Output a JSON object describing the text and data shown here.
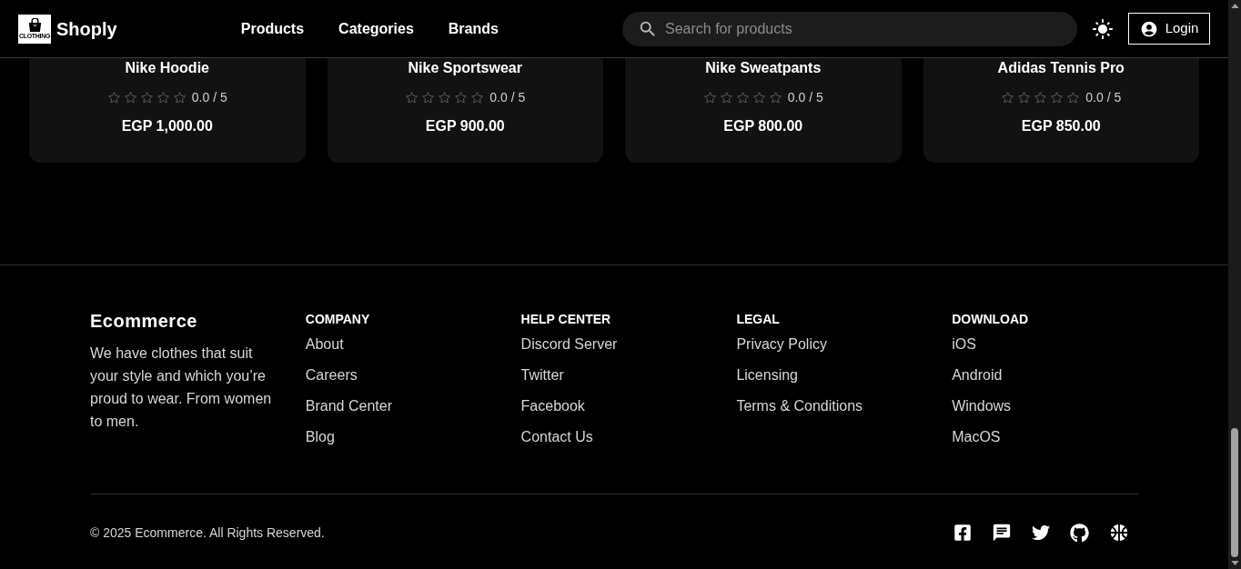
{
  "header": {
    "logo_text": "CLOTHING",
    "brand": "Shoply",
    "nav": [
      "Products",
      "Categories",
      "Brands"
    ],
    "search": {
      "placeholder": "Search for products"
    },
    "login": "Login"
  },
  "products": [
    {
      "name": "Nike Hoodie",
      "stars": 0,
      "rating": "0.0 / 5",
      "price": "EGP 1,000.00"
    },
    {
      "name": "Nike Sportswear",
      "stars": 0,
      "rating": "0.0 / 5",
      "price": "EGP 900.00"
    },
    {
      "name": "Nike Sweatpants",
      "stars": 0,
      "rating": "0.0 / 5",
      "price": "EGP 800.00"
    },
    {
      "name": "Adidas Tennis Pro",
      "stars": 0,
      "rating": "0.0 / 5",
      "price": "EGP 850.00"
    }
  ],
  "footer": {
    "brand": "Ecommerce",
    "description": "We have clothes that suit your style and which you’re proud to wear. From women to men.",
    "columns": [
      {
        "heading": "COMPANY",
        "links": [
          "About",
          "Careers",
          "Brand Center",
          "Blog"
        ]
      },
      {
        "heading": "HELP CENTER",
        "links": [
          "Discord Server",
          "Twitter",
          "Facebook",
          "Contact Us"
        ]
      },
      {
        "heading": "LEGAL",
        "links": [
          "Privacy Policy",
          "Licensing",
          "Terms & Conditions"
        ]
      },
      {
        "heading": "DOWNLOAD",
        "links": [
          "iOS",
          "Android",
          "Windows",
          "MacOS"
        ]
      }
    ],
    "copyright": "© 2025 Ecommerce. All Rights Reserved."
  }
}
